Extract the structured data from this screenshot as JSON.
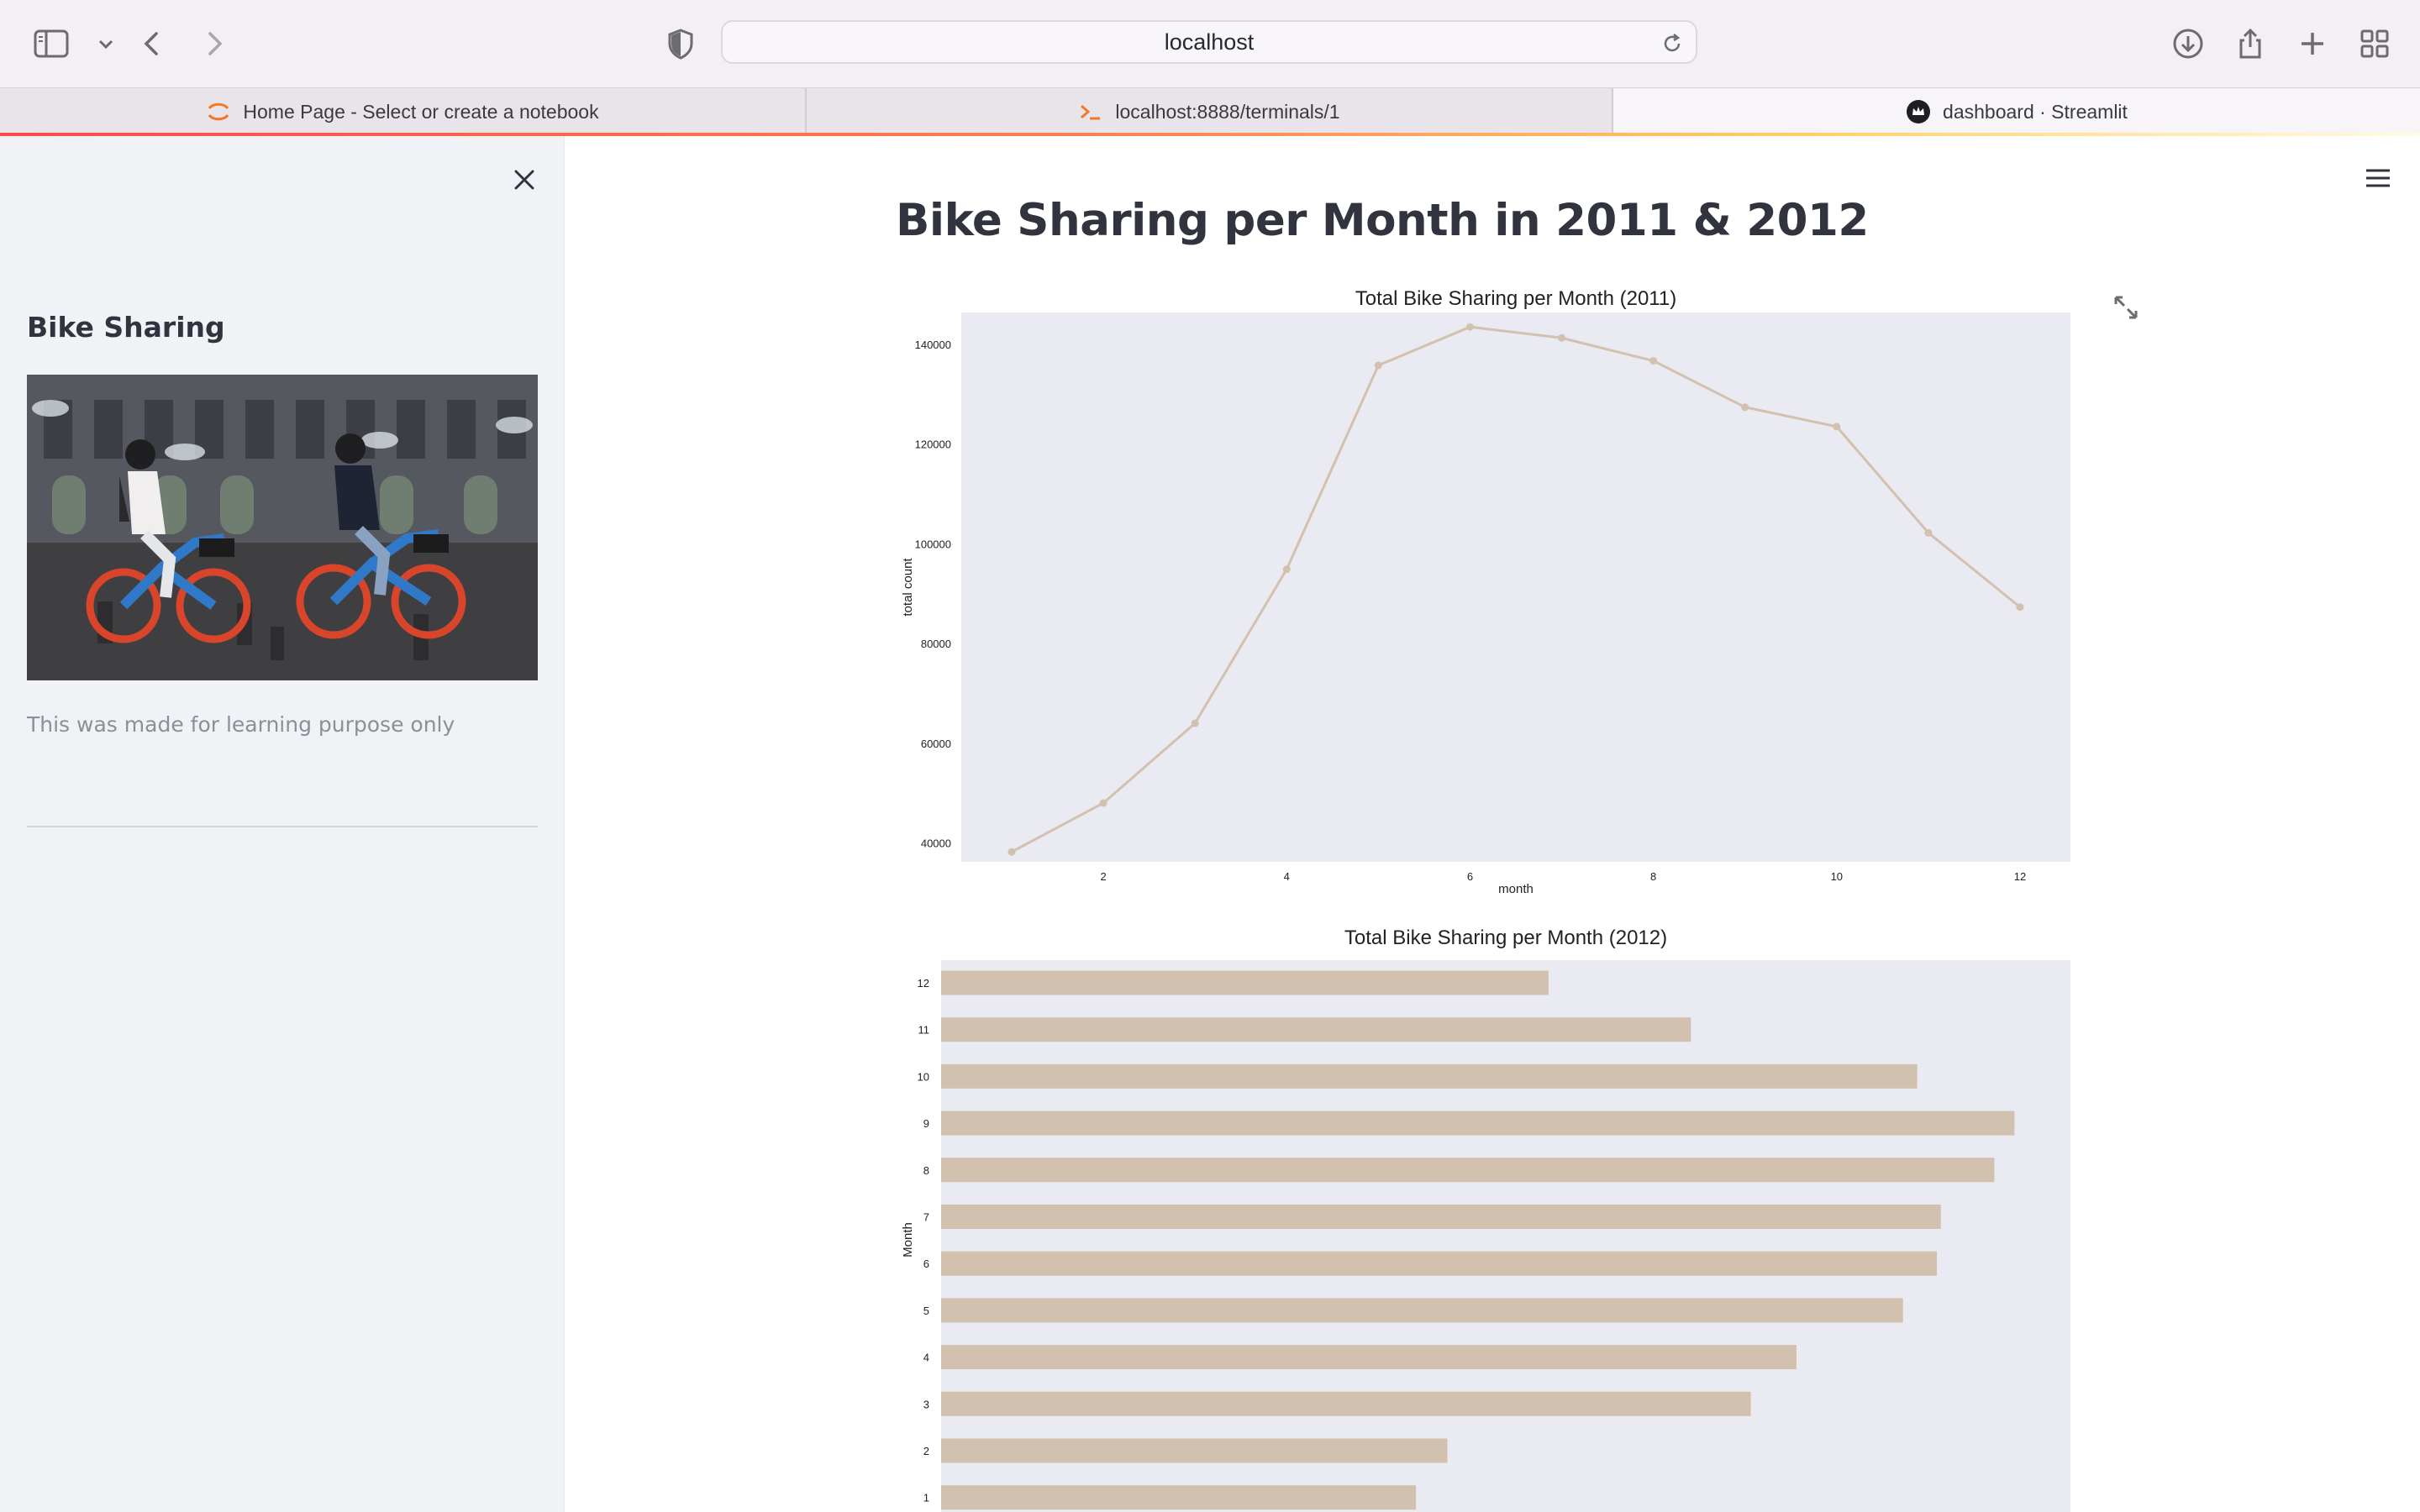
{
  "browser": {
    "url": "localhost",
    "tabs": [
      {
        "label": "Home Page - Select or create a notebook",
        "icon": "jupyter-icon"
      },
      {
        "label": "localhost:8888/terminals/1",
        "icon": "terminal-icon"
      },
      {
        "label": "dashboard · Streamlit",
        "icon": "streamlit-crown-icon"
      }
    ]
  },
  "sidebar": {
    "title": "Bike Sharing",
    "image_alt": "Two people riding blue and red shared e-bikes",
    "caption": "This was made for learning purpose only"
  },
  "main": {
    "title": "Bike Sharing per Month in 2011 & 2012"
  },
  "colors": {
    "chart_fill": "#d2c1af",
    "plot_bg": "#eaeaf2",
    "sidebar_bg": "#f0f2f6"
  },
  "chart_data": [
    {
      "type": "line",
      "title": "Total Bike Sharing per Month (2011)",
      "xlabel": "month",
      "ylabel": "total count",
      "x": [
        1,
        2,
        3,
        4,
        5,
        6,
        7,
        8,
        9,
        10,
        11,
        12
      ],
      "series": [
        {
          "values": [
            38200,
            48000,
            64000,
            94900,
            135800,
            143500,
            141300,
            136700,
            127400,
            123500,
            102200,
            87300
          ]
        }
      ],
      "xticks": [
        2,
        4,
        6,
        8,
        10,
        12
      ],
      "yticks": [
        40000,
        60000,
        80000,
        100000,
        120000,
        140000
      ],
      "xlim": [
        0.45,
        12.55
      ],
      "ylim": [
        36200,
        146400
      ],
      "grid": false,
      "color": "#d2c1af"
    },
    {
      "type": "bar",
      "orientation": "horizontal",
      "title": "Total Bike Sharing per Month (2012)",
      "xlabel": "",
      "ylabel": "Month",
      "categories": [
        "12",
        "11",
        "10",
        "9",
        "8",
        "7",
        "6",
        "5",
        "4",
        "3",
        "2",
        "1"
      ],
      "values": [
        123700,
        152700,
        198800,
        218600,
        214500,
        203600,
        202800,
        195900,
        174200,
        164900,
        103100,
        96700
      ],
      "xlim": [
        0,
        230000
      ],
      "grid": false,
      "color": "#d2c1af"
    }
  ]
}
